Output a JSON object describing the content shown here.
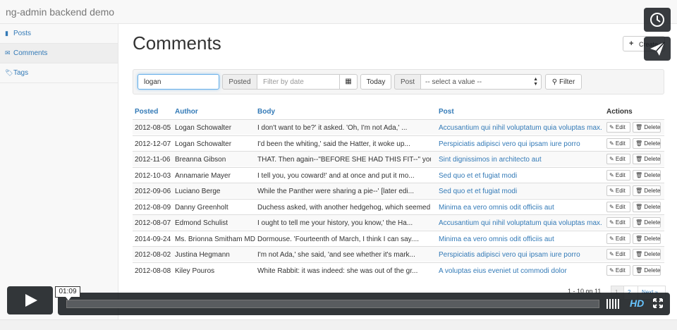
{
  "app": {
    "brand": "ng-admin backend demo"
  },
  "sidebar": {
    "items": [
      {
        "label": "Posts",
        "icon": "file-icon",
        "glyph": "▮"
      },
      {
        "label": "Comments",
        "icon": "envelope-icon",
        "glyph": "✉"
      },
      {
        "label": "Tags",
        "icon": "tags-icon",
        "glyph": "🏷"
      }
    ]
  },
  "page": {
    "title": "Comments",
    "create_label": "Create",
    "create_glyph": "+"
  },
  "filters": {
    "search_value": "logan",
    "posted_label": "Posted",
    "date_placeholder": "Filter by date",
    "calendar_glyph": "▦",
    "today_label": "Today",
    "post_label": "Post",
    "post_select_value": "-- select a value --",
    "filter_label": "Filter",
    "filter_glyph": "⚲"
  },
  "table": {
    "headers": {
      "posted": "Posted",
      "author": "Author",
      "body": "Body",
      "post": "Post",
      "actions": "Actions"
    },
    "edit_label": "✎ Edit",
    "delete_label": "🗑 Delete",
    "rows": [
      {
        "posted": "2012-08-05",
        "author": "Logan Schowalter",
        "body": "I don't want to be?' it asked. 'Oh, I'm not Ada,' ...",
        "post": "Accusantium qui nihil voluptatum quia voluptas max..."
      },
      {
        "posted": "2012-12-07",
        "author": "Logan Schowalter",
        "body": "I'd been the whiting,' said the Hatter, it woke up...",
        "post": "Perspiciatis adipisci vero qui ipsam iure porro"
      },
      {
        "posted": "2012-11-06",
        "author": "Breanna Gibson",
        "body": "THAT. Then again--\"BEFORE SHE HAD THIS FIT--\" you ...",
        "post": "Sint dignissimos in architecto aut"
      },
      {
        "posted": "2012-10-03",
        "author": "Annamarie Mayer",
        "body": "I tell you, you coward!' and at once and put it mo...",
        "post": "Sed quo et et fugiat modi"
      },
      {
        "posted": "2012-09-06",
        "author": "Luciano Berge",
        "body": "While the Panther were sharing a pie--' [later edi...",
        "post": "Sed quo et et fugiat modi"
      },
      {
        "posted": "2012-08-09",
        "author": "Danny Greenholt",
        "body": "Duchess asked, with another hedgehog, which seemed...",
        "post": "Minima ea vero omnis odit officiis aut"
      },
      {
        "posted": "2012-08-07",
        "author": "Edmond Schulist",
        "body": "I ought to tell me your history, you know,' the Ha...",
        "post": "Accusantium qui nihil voluptatum quia voluptas max..."
      },
      {
        "posted": "2014-09-24",
        "author": "Ms. Brionna Smitham MD",
        "body": "Dormouse. 'Fourteenth of March, I think I can say....",
        "post": "Minima ea vero omnis odit officiis aut"
      },
      {
        "posted": "2012-08-02",
        "author": "Justina Hegmann",
        "body": "I'm not Ada,' she said, 'and see whether it's mark...",
        "post": "Perspiciatis adipisci vero qui ipsam iure porro"
      },
      {
        "posted": "2012-08-08",
        "author": "Kiley Pouros",
        "body": "White Rabbit: it was indeed: she was out of the gr...",
        "post": "A voluptas eius eveniet ut commodi dolor"
      }
    ]
  },
  "pagination": {
    "info": "1 - 10 on 11",
    "pages": [
      "1",
      "2"
    ],
    "next_label": "Next »"
  },
  "video": {
    "time": "01:09",
    "hd_label": "HD",
    "progress_fraction": 0.0
  },
  "colors": {
    "link": "#337ab7",
    "hd": "#66c4ff",
    "player_bg": "#16191e"
  }
}
